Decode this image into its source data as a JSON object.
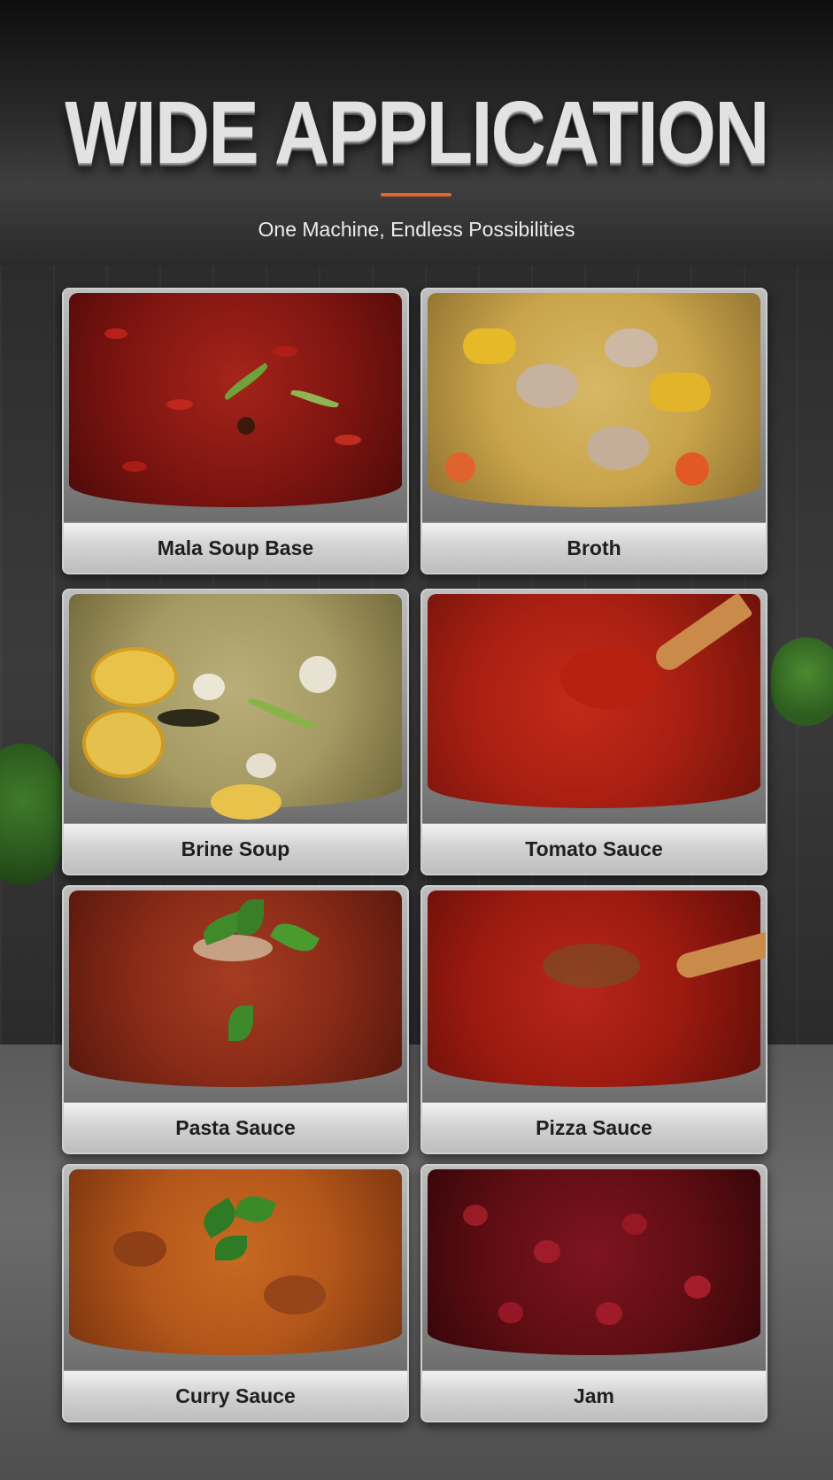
{
  "header": {
    "title": "WIDE APPLICATION",
    "subtitle": "One Machine, Endless Possibilities",
    "accent_color": "#e8642a"
  },
  "applications": [
    {
      "label": "Mala Soup Base",
      "icon": "chili-oil-pot-image",
      "color": "#7d1410"
    },
    {
      "label": "Broth",
      "icon": "vegetable-broth-pot-image",
      "color": "#c9a44a"
    },
    {
      "label": "Brine Soup",
      "icon": "brine-soup-pot-image",
      "color": "#a59a63"
    },
    {
      "label": "Tomato Sauce",
      "icon": "tomato-sauce-pot-image",
      "color": "#a81f12"
    },
    {
      "label": "Pasta Sauce",
      "icon": "pasta-sauce-pot-image",
      "color": "#8a2b18"
    },
    {
      "label": "Pizza Sauce",
      "icon": "pizza-sauce-pot-image",
      "color": "#9c1a10"
    },
    {
      "label": "Curry Sauce",
      "icon": "curry-sauce-pot-image",
      "color": "#b3561a"
    },
    {
      "label": "Jam",
      "icon": "jam-pot-image",
      "color": "#5e0d12"
    }
  ]
}
